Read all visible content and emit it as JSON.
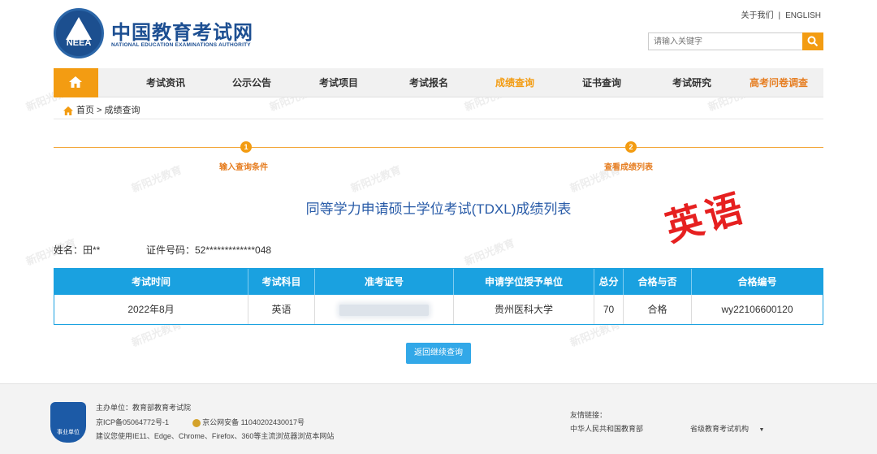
{
  "header": {
    "logo_emblem_text": "NEEA",
    "logo_title": "中国教育考试网",
    "logo_subtitle": "NATIONAL EDUCATION EXAMINATIONS AUTHORITY",
    "about_link": "关于我们",
    "separator": "|",
    "english_link": "ENGLISH",
    "search_placeholder": "请输入关键字"
  },
  "nav": {
    "items": [
      {
        "label": "考试资讯"
      },
      {
        "label": "公示公告"
      },
      {
        "label": "考试项目"
      },
      {
        "label": "考试报名"
      },
      {
        "label": "成绩查询"
      },
      {
        "label": "证书查询"
      },
      {
        "label": "考试研究"
      },
      {
        "label": "高考问卷调查"
      }
    ]
  },
  "breadcrumb": "首页 > 成绩查询",
  "steps": [
    {
      "num": "1",
      "label": "输入查询条件"
    },
    {
      "num": "2",
      "label": "查看成绩列表"
    }
  ],
  "page_title": "同等学力申请硕士学位考试(TDXL)成绩列表",
  "stamp": "英语",
  "info": {
    "name": "姓名：田**",
    "id": "证件号码：52*************048"
  },
  "table": {
    "headers": [
      "考试时间",
      "考试科目",
      "准考证号",
      "申请学位授予单位",
      "总分",
      "合格与否",
      "合格编号"
    ],
    "rows": [
      [
        "2022年8月",
        "英语",
        "",
        "贵州医科大学",
        "70",
        "合格",
        "wy22106600120"
      ]
    ]
  },
  "back_button": "返回继续查询",
  "footer": {
    "badge": "事业单位",
    "host": "主办单位：教育部教育考试院",
    "icp": "京ICP备05064772号-1",
    "police": "京公网安备 11040202430017号",
    "browser": "建议您使用IE11、Edge、Chrome、Firefox、360等主流浏览器浏览本网站",
    "links_label": "友情链接：",
    "link1": "中华人民共和国教育部",
    "select_label": "省级教育考试机构",
    "select_arrow": "▼"
  },
  "watermark": "新阳光教育",
  "colors": {
    "brand_blue": "#1d4f92",
    "accent_orange": "#f39c12",
    "table_blue": "#1aa1e0",
    "stamp_red": "#e62020"
  }
}
